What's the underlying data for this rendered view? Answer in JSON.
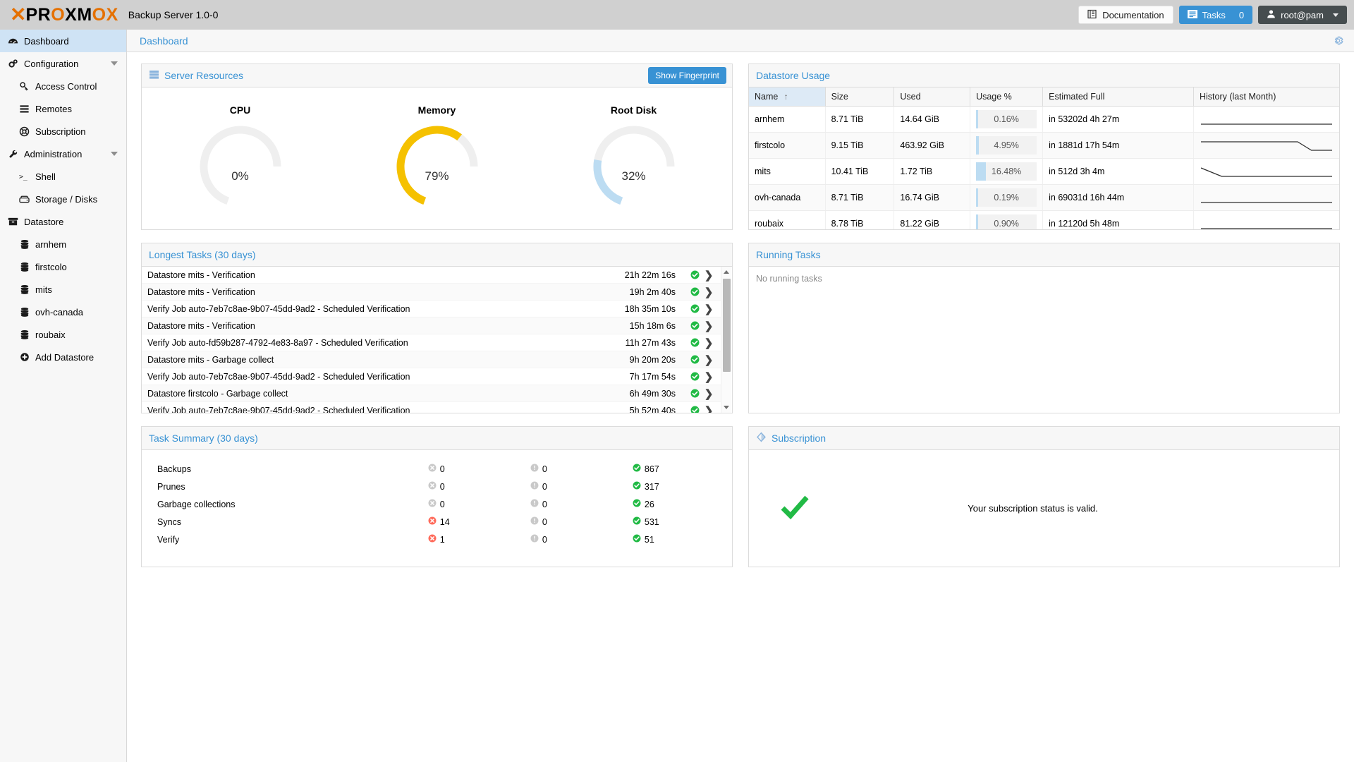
{
  "header": {
    "logo_x": "X",
    "logo_text_parts": [
      "PR",
      "O",
      "XM",
      "O",
      "X"
    ],
    "product_title": "Backup Server 1.0-0",
    "documentation_label": "Documentation",
    "tasks_label": "Tasks",
    "tasks_count": "0",
    "user_label": "root@pam",
    "icons": {
      "documentation": "book-icon",
      "tasks": "list-icon",
      "user": "user-icon",
      "caret": "chevron-down-icon"
    }
  },
  "breadcrumb": {
    "text": "Dashboard",
    "gear_icon": "gear-icon"
  },
  "sidebar": {
    "items": [
      {
        "label": "Dashboard",
        "icon": "dashboard-icon",
        "indent": false,
        "selected": true,
        "expandable": false
      },
      {
        "label": "Configuration",
        "icon": "gears-icon",
        "indent": false,
        "selected": false,
        "expandable": true
      },
      {
        "label": "Access Control",
        "icon": "key-icon",
        "indent": true,
        "selected": false,
        "expandable": false
      },
      {
        "label": "Remotes",
        "icon": "list-icon",
        "indent": true,
        "selected": false,
        "expandable": false
      },
      {
        "label": "Subscription",
        "icon": "lifebuoy-icon",
        "indent": true,
        "selected": false,
        "expandable": false
      },
      {
        "label": "Administration",
        "icon": "wrench-icon",
        "indent": false,
        "selected": false,
        "expandable": true
      },
      {
        "label": "Shell",
        "icon": "terminal-icon",
        "indent": true,
        "selected": false,
        "expandable": false
      },
      {
        "label": "Storage / Disks",
        "icon": "disk-icon",
        "indent": true,
        "selected": false,
        "expandable": false
      },
      {
        "label": "Datastore",
        "icon": "archive-icon",
        "indent": false,
        "selected": false,
        "expandable": false
      },
      {
        "label": "arnhem",
        "icon": "database-icon",
        "indent": true,
        "selected": false,
        "expandable": false
      },
      {
        "label": "firstcolo",
        "icon": "database-icon",
        "indent": true,
        "selected": false,
        "expandable": false
      },
      {
        "label": "mits",
        "icon": "database-icon",
        "indent": true,
        "selected": false,
        "expandable": false
      },
      {
        "label": "ovh-canada",
        "icon": "database-icon",
        "indent": true,
        "selected": false,
        "expandable": false
      },
      {
        "label": "roubaix",
        "icon": "database-icon",
        "indent": true,
        "selected": false,
        "expandable": false
      },
      {
        "label": "Add Datastore",
        "icon": "plus-circle-icon",
        "indent": true,
        "selected": false,
        "expandable": false
      }
    ]
  },
  "server_resources": {
    "title": "Server Resources",
    "icon": "server-icon",
    "fingerprint_button": "Show Fingerprint",
    "gauges": [
      {
        "label": "CPU",
        "value": 0,
        "display": "0%",
        "color": "#efefef"
      },
      {
        "label": "Memory",
        "value": 79,
        "display": "79%",
        "color": "#f5c100"
      },
      {
        "label": "Root Disk",
        "value": 32,
        "display": "32%",
        "color": "#bcdcf2"
      }
    ],
    "track_color": "#efefef"
  },
  "datastore_usage": {
    "title": "Datastore Usage",
    "columns": [
      "Name",
      "Size",
      "Used",
      "Usage %",
      "Estimated Full",
      "History (last Month)"
    ],
    "sort_column": "Name",
    "sort_indicator": "↑",
    "rows": [
      {
        "name": "arnhem",
        "size": "8.71 TiB",
        "used": "14.64 GiB",
        "usage_pct": "0.16%",
        "usage_value": 0.16,
        "estimated_full": "in 53202d 4h 27m",
        "history": [
          50,
          50,
          50,
          50,
          50,
          50,
          50,
          50,
          50,
          50,
          50,
          50,
          50,
          50,
          50,
          50,
          50,
          50,
          50,
          50
        ]
      },
      {
        "name": "firstcolo",
        "size": "9.15 TiB",
        "used": "463.92 GiB",
        "usage_pct": "4.95%",
        "usage_value": 4.95,
        "estimated_full": "in 1881d 17h 54m",
        "history": [
          50,
          50,
          50,
          50,
          50,
          50,
          50,
          50,
          50,
          50,
          50,
          50,
          50,
          50,
          50,
          48,
          46,
          46,
          46,
          46
        ]
      },
      {
        "name": "mits",
        "size": "10.41 TiB",
        "used": "1.72 TiB",
        "usage_pct": "16.48%",
        "usage_value": 16.48,
        "estimated_full": "in 512d 3h 4m",
        "history": [
          56,
          54,
          52,
          50,
          50,
          50,
          50,
          50,
          50,
          50,
          50,
          50,
          50,
          50,
          50,
          50,
          50,
          50,
          50,
          50
        ]
      },
      {
        "name": "ovh-canada",
        "size": "8.71 TiB",
        "used": "16.74 GiB",
        "usage_pct": "0.19%",
        "usage_value": 0.19,
        "estimated_full": "in 69031d 16h 44m",
        "history": [
          50,
          50,
          50,
          50,
          50,
          50,
          50,
          50,
          50,
          50,
          50,
          50,
          50,
          50,
          50,
          50,
          50,
          50,
          50,
          50
        ]
      },
      {
        "name": "roubaix",
        "size": "8.78 TiB",
        "used": "81.22 GiB",
        "usage_pct": "0.90%",
        "usage_value": 0.9,
        "estimated_full": "in 12120d 5h 48m",
        "history": [
          50,
          50,
          50,
          50,
          50,
          50,
          50,
          50,
          50,
          50,
          50,
          50,
          50,
          50,
          50,
          50,
          50,
          50,
          50,
          50
        ]
      }
    ]
  },
  "longest_tasks": {
    "title": "Longest Tasks (30 days)",
    "rows": [
      {
        "description": "Datastore mits - Verification",
        "duration": "21h 22m 16s",
        "status": "ok"
      },
      {
        "description": "Datastore mits - Verification",
        "duration": "19h 2m 40s",
        "status": "ok"
      },
      {
        "description": "Verify Job auto-7eb7c8ae-9b07-45dd-9ad2 - Scheduled Verification",
        "duration": "18h 35m 10s",
        "status": "ok"
      },
      {
        "description": "Datastore mits - Verification",
        "duration": "15h 18m 6s",
        "status": "ok"
      },
      {
        "description": "Verify Job auto-fd59b287-4792-4e83-8a97 - Scheduled Verification",
        "duration": "11h 27m 43s",
        "status": "ok"
      },
      {
        "description": "Datastore mits - Garbage collect",
        "duration": "9h 20m 20s",
        "status": "ok"
      },
      {
        "description": "Verify Job auto-7eb7c8ae-9b07-45dd-9ad2 - Scheduled Verification",
        "duration": "7h 17m 54s",
        "status": "ok"
      },
      {
        "description": "Datastore firstcolo - Garbage collect",
        "duration": "6h 49m 30s",
        "status": "ok"
      },
      {
        "description": "Verify Job auto-7eb7c8ae-9b07-45dd-9ad2 - Scheduled Verification",
        "duration": "5h 52m 40s",
        "status": "ok"
      }
    ],
    "chevron_icon": "chevron-right-icon",
    "scrollbar": {
      "up_icon": "triangle-up-icon",
      "down_icon": "triangle-down-icon"
    }
  },
  "running_tasks": {
    "title": "Running Tasks",
    "empty_text": "No running tasks"
  },
  "task_summary": {
    "title": "Task Summary (30 days)",
    "rows": [
      {
        "label": "Backups",
        "errors": "0",
        "errors_active": false,
        "warnings": "0",
        "ok": "867"
      },
      {
        "label": "Prunes",
        "errors": "0",
        "errors_active": false,
        "warnings": "0",
        "ok": "317"
      },
      {
        "label": "Garbage collections",
        "errors": "0",
        "errors_active": false,
        "warnings": "0",
        "ok": "26"
      },
      {
        "label": "Syncs",
        "errors": "14",
        "errors_active": true,
        "warnings": "0",
        "ok": "531"
      },
      {
        "label": "Verify",
        "errors": "1",
        "errors_active": true,
        "warnings": "0",
        "ok": "51"
      }
    ]
  },
  "subscription": {
    "title": "Subscription",
    "icon": "diamond-icon",
    "status_message": "Your subscription status is valid.",
    "status_icon": "green-check-icon"
  },
  "colors": {
    "accent_blue": "#3892d4",
    "brand_orange": "#e57000",
    "ok_green": "#21ba45",
    "error_red": "#ff6a5a",
    "warn_gray": "#bdbdbd",
    "memory_yellow": "#f5c100",
    "disk_blue": "#bcdcf2"
  }
}
